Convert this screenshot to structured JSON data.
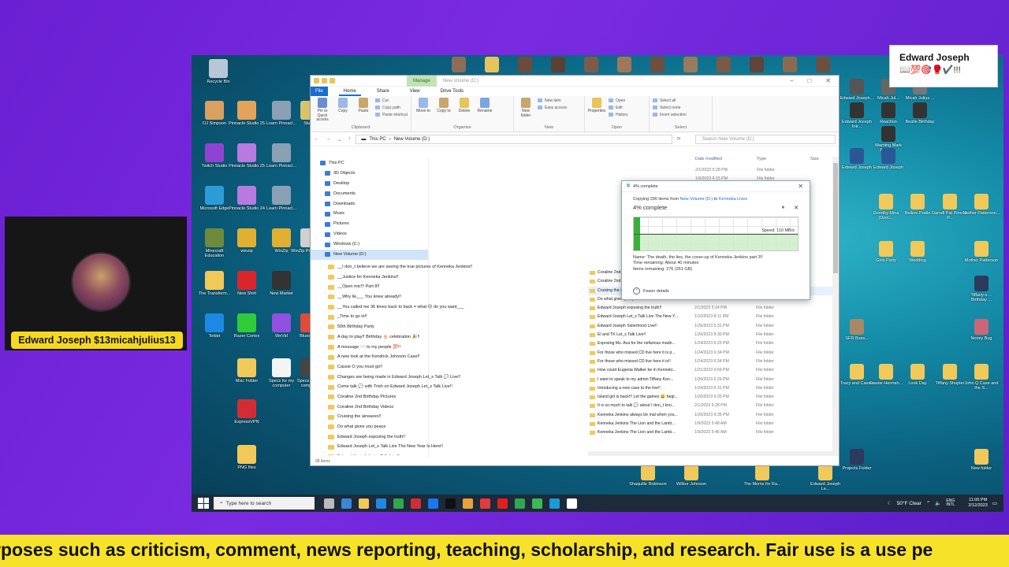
{
  "desktop": {
    "left_icons": [
      {
        "label": "Recycle Bin",
        "color": "#b8c7d6"
      },
      {
        "label": "OJ Simpson",
        "color": "#d9a060"
      },
      {
        "label": "Pinnacle Studio 25",
        "color": "#e4a35a"
      },
      {
        "label": "Learn Pinnacl...",
        "color": "#8aa0b4"
      },
      {
        "label": "Studio",
        "color": "#d7c46a"
      },
      {
        "label": "Twitch Studio",
        "color": "#8e44d0"
      },
      {
        "label": "Pinnacle Studio 25",
        "color": "#b87ae0"
      },
      {
        "label": "Learn Pinnacl...",
        "color": "#8aa0b4"
      },
      {
        "label": "Microsoft Edge",
        "color": "#2d9bd6"
      },
      {
        "label": "Pinnacle Studio 24",
        "color": "#b87ae0"
      },
      {
        "label": "Learn Pinnacl...",
        "color": "#8aa0b4"
      },
      {
        "label": "Minecraft Education",
        "color": "#6e8a3a"
      },
      {
        "label": "winzip",
        "color": "#e0b030"
      },
      {
        "label": "WinZip",
        "color": "#e0b030"
      },
      {
        "label": "WinZip Pro Expre...",
        "color": "#d0d0d0"
      },
      {
        "label": "The Transform...",
        "color": "#f0c95a"
      },
      {
        "label": "New Shirt",
        "color": "#d8272c"
      },
      {
        "label": "New Market",
        "color": "#333"
      },
      {
        "label": "Teldet",
        "color": "#1e88e5"
      },
      {
        "label": "Razer Cortex",
        "color": "#2fcc3a"
      },
      {
        "label": "WeVid",
        "color": "#9050e0"
      },
      {
        "label": "Bluestac...",
        "color": "#e04b3a"
      },
      {
        "label": "Misc Folder",
        "color": "#f0c95a"
      },
      {
        "label": "Specs for my computer",
        "color": "#f4f4f4"
      },
      {
        "label": "Specs for my comput...",
        "color": "#444"
      },
      {
        "label": "ExpressVPN",
        "color": "#d22d35"
      },
      {
        "label": "PNG files",
        "color": "#f0c95a"
      }
    ],
    "right_icons": [
      {
        "label": "Edward Joseph...",
        "color": "#555"
      },
      {
        "label": "Micah Jul...",
        "color": "#666"
      },
      {
        "label": "Micah Julius ...",
        "color": "#777"
      },
      {
        "label": "Edward Joseph Intr...",
        "color": "#333"
      },
      {
        "label": "Reaction",
        "color": "#333"
      },
      {
        "label": "Bealle Birthday",
        "color": "#333"
      },
      {
        "label": "Warning Mark Adams...",
        "color": "#333"
      },
      {
        "label": "Edward Joseph",
        "color": "#2b5797"
      },
      {
        "label": "Edward Joseph",
        "color": "#2b5797"
      },
      {
        "label": "Dorothy Mina (Doric...",
        "color": "#f0c95a"
      },
      {
        "label": "Belleni Pratts",
        "color": "#f0c95a"
      },
      {
        "label": "Darrell Pat Piner is P...",
        "color": "#f0c95a"
      },
      {
        "label": "Mother Patterson...",
        "color": "#f0c95a"
      },
      {
        "label": "Girls Party",
        "color": "#f0c95a"
      },
      {
        "label": "Wedding",
        "color": "#f0c95a"
      },
      {
        "label": "Mother Patterson",
        "color": "#f0c95a"
      },
      {
        "label": "Tiffany-s ... Birthday ...",
        "color": "#2b3a5e"
      },
      {
        "label": "SFR Buss...",
        "color": "#aa8866"
      },
      {
        "label": "Novey Bug",
        "color": "#cc6677"
      },
      {
        "label": "Tracy and Cassie",
        "color": "#f0c95a"
      },
      {
        "label": "Cassie Hennah...",
        "color": "#f0c95a"
      },
      {
        "label": "Look Day",
        "color": "#f0c95a"
      },
      {
        "label": "Tiffany Shopler",
        "color": "#f0c95a"
      },
      {
        "label": "John Q Case and the S...",
        "color": "#f0c95a"
      },
      {
        "label": "Shaquille Robinson",
        "color": "#f0c95a"
      },
      {
        "label": "Wilbur Johnson",
        "color": "#f0c95a"
      },
      {
        "label": "The Moms for Ra...",
        "color": "#f0c95a"
      },
      {
        "label": "Edward Joseph Le...",
        "color": "#f0c95a"
      },
      {
        "label": "Projects Folder",
        "color": "#2b3a5e"
      },
      {
        "label": "New folder",
        "color": "#f0c95a"
      }
    ]
  },
  "explorer": {
    "quick_access_title": "New Volume (D:)",
    "manage_tab": "Manage",
    "ribbon_tabs": [
      "File",
      "Home",
      "Share",
      "View",
      "Drive Tools"
    ],
    "ribbon_groups": [
      {
        "label": "Clipboard",
        "buttons": [
          "Pin to Quick access",
          "Copy",
          "Paste"
        ],
        "small": [
          "Cut",
          "Copy path",
          "Paste shortcut"
        ]
      },
      {
        "label": "Organize",
        "buttons": [
          "Move to",
          "Copy to",
          "Delete",
          "Rename"
        ],
        "small": []
      },
      {
        "label": "New",
        "buttons": [
          "New folder"
        ],
        "small": [
          "New item",
          "Easy access"
        ]
      },
      {
        "label": "Open",
        "buttons": [
          "Properties"
        ],
        "small": [
          "Open",
          "Edit",
          "History"
        ]
      },
      {
        "label": "Select",
        "buttons": [],
        "small": [
          "Select all",
          "Select none",
          "Invert selection"
        ]
      }
    ],
    "breadcrumb": [
      "This PC",
      "New Volume (D:)"
    ],
    "search_placeholder": "Search New Volume (D:)",
    "nav_items": [
      "This PC",
      "3D Objects",
      "Desktop",
      "Documents",
      "Downloads",
      "Music",
      "Pictures",
      "Videos",
      "Windows (C:)",
      "New Volume (D:)"
    ],
    "tree_items": [
      "__I don_t believe we are seeing the true pictures of Kenneka Jenkins!!",
      "__Justice for Kenneka Jenkins!!",
      "__Open mic!!! Part 8!!",
      "__Why lie___ You knew already!!",
      "__You called me 36 times back to back = what ☹ do you want___",
      "_Time to go in!!",
      "50th Birthday Party",
      "A day to play!! Birthday 🎂 celebration 🎉!!",
      "A message 📨 to my people 💯!!",
      "A new look at the Kendrick Johnson Case!!",
      "Cassie O you must go!!",
      "Changes are being made in Edward Joseph Let_s Talk 💬 Live!!",
      "Come talk 💬 with Trish on Edward Joseph Let_s Talk Live!!",
      "Coraline 2nd Birthday Pictures",
      "Coraline 2nd Birthday Videos",
      "Cruising the airwaves!!",
      "Do what gives you peace",
      "Edward Joseph exposing the truth!!",
      "Edward Joseph Let_s Talk Live The New Year Is Here!!",
      "Edward Joseph Let_s Talk Live!!"
    ],
    "item_count": "68 items",
    "columns": {
      "date": "Date modified",
      "type": "Type",
      "size": "Size"
    },
    "rows": [
      {
        "name": "Coraline 2nd Birthday Pictures",
        "date": "1/26/2023 9:52 PM",
        "type": "File folder"
      },
      {
        "name": "Coraline 2nd Birthday Videos",
        "date": "1/26/2023 9:51 PM",
        "type": "File folder"
      },
      {
        "name": "Cruising the airwaves!!",
        "date": "2/1/2023 5:25 PM",
        "type": "File folder"
      },
      {
        "name": "Do what gives you peace",
        "date": "2/1/2023 5:24 PM",
        "type": "File folder"
      },
      {
        "name": "Edward Joseph exposing the truth!!",
        "date": "2/1/2023 5:24 PM",
        "type": "File folder"
      },
      {
        "name": "Edward Joseph Let_s Talk Live The New Y...",
        "date": "1/10/2023 8:11 PM",
        "type": "File folder"
      },
      {
        "name": "Edward Joseph Sisterhood Live!!",
        "date": "1/26/2023 5:31 PM",
        "type": "File folder"
      },
      {
        "name": "El and TK Let_s Talk Live!!",
        "date": "1/26/2023 8:30 PM",
        "type": "File folder"
      },
      {
        "name": "Exposing Ms. Ava for the nefarious madn...",
        "date": "1/24/2023 6:25 PM",
        "type": "File folder"
      },
      {
        "name": "For those who missed CD live here it is p...",
        "date": "1/24/2023 6:34 PM",
        "type": "File folder"
      },
      {
        "name": "For those who missed CD live here it is!!",
        "date": "1/24/2023 6:34 PM",
        "type": "File folder"
      },
      {
        "name": "How could Eugenia Walker be in Kenneki...",
        "date": "1/21/2023 9:59 PM",
        "type": "File folder"
      },
      {
        "name": "I want to speak to my admin Tiffany Ken...",
        "date": "1/26/2023 5:29 PM",
        "type": "File folder"
      },
      {
        "name": "Introducing a new case to the live!!",
        "date": "1/24/2023 6:31 PM",
        "type": "File folder"
      },
      {
        "name": "Island girl is back!!! Let the games 😀 begi...",
        "date": "1/26/2023 9:35 PM",
        "type": "File folder"
      },
      {
        "name": "It is so much to talk 💬 about I don_t kno...",
        "date": "2/1/2023 5:28 PM",
        "type": "File folder"
      },
      {
        "name": "Kenneka Jenkins always be mal when you...",
        "date": "1/26/2023 9:35 PM",
        "type": "File folder"
      },
      {
        "name": "Kenneka Jenkins The Lion and the Lamb...",
        "date": "1/9/2023 5:48 AM",
        "type": "File folder"
      },
      {
        "name": "Kenneka Jenkins The Lion and the Lamb...",
        "date": "1/9/2023 5:46 AM",
        "type": "File folder"
      }
    ],
    "hidden_dates": [
      {
        "date": "2/1/2023 5:28 PM",
        "type": "File folder"
      },
      {
        "date": "1/6/2023 6:15 PM",
        "type": "File folder"
      },
      {
        "date": "1/26/2023 9:55 PM",
        "type": "File folder"
      },
      {
        "date": "1/16/2023 8:09 PM",
        "type": "File folder"
      },
      {
        "date": "2/1/2023 5:24 PM",
        "type": "File folder"
      },
      {
        "date": "1/8/2023 9:57 PM",
        "type": "File folder"
      },
      {
        "date": "1/26/2023 9:57 PM",
        "type": "File folder"
      },
      {
        "date": "1/24/2023 6:34 PM",
        "type": "File folder"
      },
      {
        "date": "1/24/2023 6:26 PM",
        "type": "File folder"
      },
      {
        "date": "1/5/2023 6:58 PM",
        "type": "File folder"
      },
      {
        "date": "2/1/2023 5:20 PM",
        "type": "File folder"
      },
      {
        "date": "1/26/2023 9:38 PM",
        "type": "File folder"
      }
    ]
  },
  "copy_dialog": {
    "title": "4% complete",
    "copying_prefix": "Copying 290 items from",
    "source": "New Volume (D:)",
    "to_word": "to",
    "destination": "Kenneka Lives",
    "percent_text": "4% complete",
    "progress_fraction": 0.04,
    "speed": "Speed: 110 MB/s",
    "name": "Name: The death, the lies, the cover-up of Kenneka Jenkins part 3!!",
    "time_remaining": "Time remaining: About 40 minutes",
    "items_remaining": "Items remaining: 276 (261 GB)",
    "fewer_details": "Fewer details"
  },
  "taskbar": {
    "search_placeholder": "Type here to search",
    "weather": "50°F Clear",
    "lang": "ENG INTL",
    "time": "11:06 PM",
    "date": "2/12/2023",
    "app_colors": [
      "#bbbbbb",
      "#3a86d8",
      "#f0c95a",
      "#1e88e5",
      "#2fa84f",
      "#d22d35",
      "#1877f2",
      "#111",
      "#e8a23a",
      "#e23b3b",
      "#e02020",
      "#2fa84f",
      "#3cba54",
      "#1a9ad6",
      "#ffffff"
    ]
  },
  "webcam": {
    "name_label": "Edward Joseph $13micahjulius13"
  },
  "name_card": {
    "name": "Edward Joseph",
    "emojis": "📖💯🎯🥊✔️!!!"
  },
  "ticker": {
    "text": "rposes such as criticism, comment, news reporting, teaching, scholarship, and research. Fair use is a use pe"
  }
}
